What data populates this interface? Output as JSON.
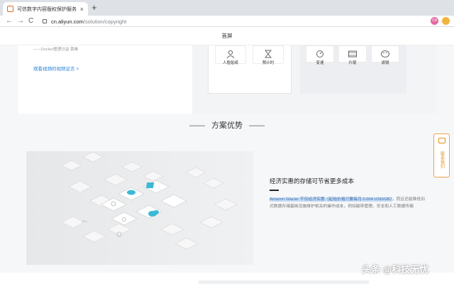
{
  "browser": {
    "tab_title": "可信数字内容版权保护服务",
    "tab_close": "×",
    "new_tab": "+",
    "back": "←",
    "forward": "→",
    "reload": "C",
    "url_host": "cn.aliyun.com",
    "url_path": "/solution/copyright",
    "ext_label": "CR"
  },
  "page": {
    "nav_title": "首屏",
    "quote": "——Docker整理日益 黄峰",
    "cases_link": "观看视频的视频证言 >",
    "features_a": [
      {
        "label": "人脸贴纸",
        "icon": "person-icon"
      },
      {
        "label": "预计时",
        "icon": "hourglass-icon"
      }
    ],
    "features_b": [
      {
        "label": "变速",
        "icon": "speed-gauge-icon"
      },
      {
        "label": "片尾",
        "icon": "film-icon"
      },
      {
        "label": "滤镜",
        "icon": "palette-icon"
      }
    ],
    "section_title": "方案优势",
    "section_dash": "——",
    "advantage_title": "经济实惠的存储可节省更多成本",
    "advantage_highlight": "Amazon Glacier 不仅经济实惠（起始价格只要每月 0.004 USD/GB）",
    "advantage_rest": "，而且还能降低旧式数据存储基础设施维护相关的操作成本，例如磁带管理、安全和人工数据传输",
    "float_consult": "联系我们",
    "watermark": "头条 @科技无忧"
  },
  "colors": {
    "accent": "#e38a1c",
    "link": "#2a7fd4",
    "highlight": "#c8dcf5",
    "teal": "#3bb9d6"
  }
}
